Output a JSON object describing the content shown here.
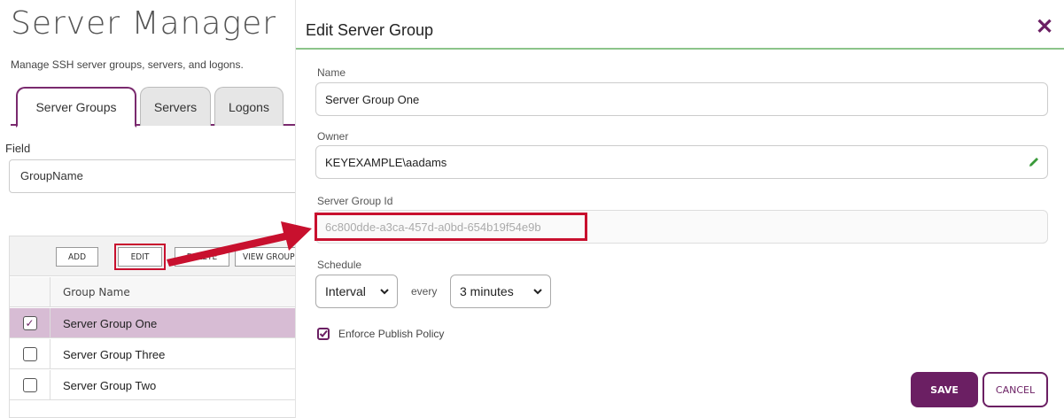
{
  "app": {
    "title": "Server Manager",
    "subtitle": "Manage SSH server groups, servers, and logons."
  },
  "tabs": [
    {
      "label": "Server Groups",
      "active": true
    },
    {
      "label": "Servers",
      "active": false
    },
    {
      "label": "Logons",
      "active": false
    }
  ],
  "filter": {
    "field_label": "Field",
    "field_value": "GroupName"
  },
  "toolbar": {
    "add": "ADD",
    "edit": "EDIT",
    "delete": "DELETE",
    "view": "VIEW GROUP"
  },
  "grid": {
    "column_header": "Group Name",
    "rows": [
      {
        "name": "Server Group One",
        "checked": true
      },
      {
        "name": "Server Group Three",
        "checked": false
      },
      {
        "name": "Server Group Two",
        "checked": false
      }
    ]
  },
  "dialog": {
    "title": "Edit Server Group",
    "name_label": "Name",
    "name_value": "Server Group One",
    "owner_label": "Owner",
    "owner_value": "KEYEXAMPLE\\aadams",
    "id_label": "Server Group Id",
    "id_value": "6c800dde-a3ca-457d-a0bd-654b19f54e9b",
    "schedule_label": "Schedule",
    "schedule_type": "Interval",
    "every_label": "every",
    "schedule_interval": "3 minutes",
    "enforce_label": "Enforce Publish Policy",
    "enforce_checked": true,
    "save": "SAVE",
    "cancel": "CANCEL"
  },
  "colors": {
    "accent": "#6b1f63",
    "highlight": "#c8102e",
    "header_rule": "#8cc48a",
    "selected_row": "#d7bcd4"
  }
}
